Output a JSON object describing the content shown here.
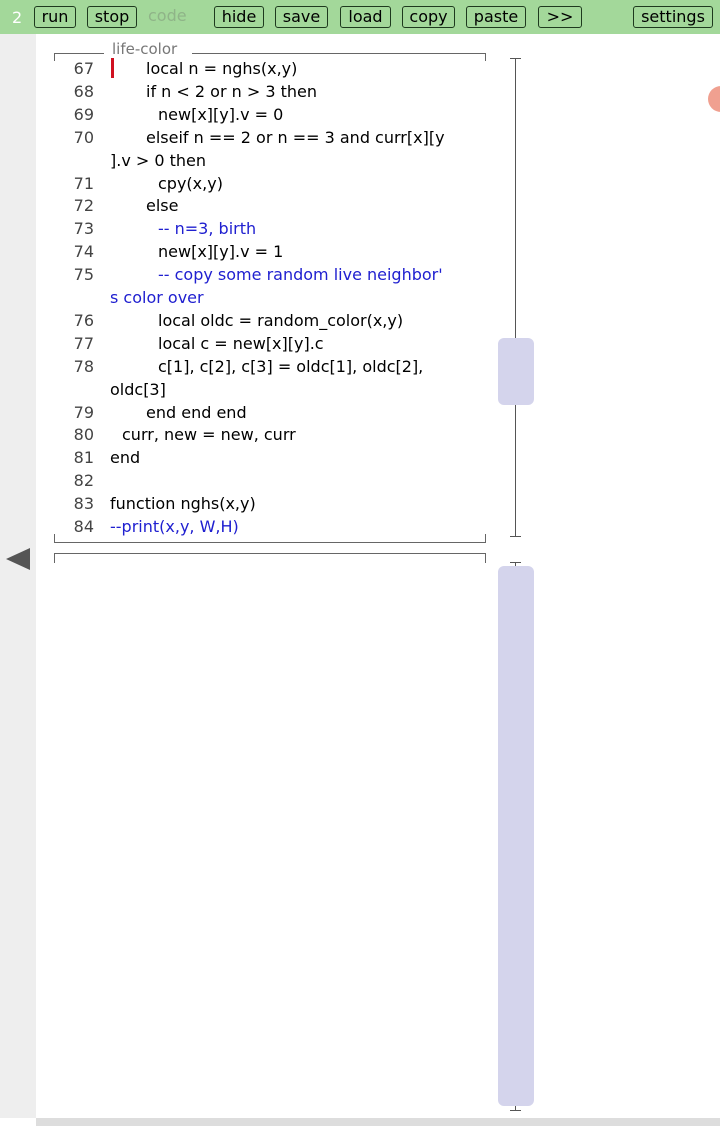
{
  "toolbar": {
    "tab_number": "2",
    "run_label": "run",
    "stop_label": "stop",
    "code_label": "code",
    "hide_label": "hide",
    "save_label": "save",
    "load_label": "load",
    "copy_label": "copy",
    "paste_label": "paste",
    "more_label": ">>",
    "settings_label": "settings"
  },
  "editor": {
    "title": "life-color",
    "lines": [
      {
        "num": "67",
        "text": "local n = nghs(x,y)",
        "indent": 3,
        "kind": "code"
      },
      {
        "num": "68",
        "text": "if n < 2 or n > 3 then",
        "indent": 3,
        "kind": "code"
      },
      {
        "num": "69",
        "text": "new[x][y].v = 0",
        "indent": 4,
        "kind": "code"
      },
      {
        "num": "70",
        "text": "elseif n == 2 or n == 3 and curr[x][y",
        "indent": 3,
        "kind": "code"
      },
      {
        "num": "",
        "text": "].v > 0 then",
        "indent": 0,
        "kind": "code"
      },
      {
        "num": "71",
        "text": "cpy(x,y)",
        "indent": 4,
        "kind": "code"
      },
      {
        "num": "72",
        "text": "else",
        "indent": 3,
        "kind": "code"
      },
      {
        "num": "73",
        "text": "-- n=3, birth",
        "indent": 4,
        "kind": "comment"
      },
      {
        "num": "74",
        "text": "new[x][y].v = 1",
        "indent": 4,
        "kind": "code"
      },
      {
        "num": "75",
        "text": "-- copy some random live neighbor'",
        "indent": 4,
        "kind": "comment"
      },
      {
        "num": "",
        "text": "s color over",
        "indent": 0,
        "kind": "comment"
      },
      {
        "num": "76",
        "text": "local oldc = random_color(x,y)",
        "indent": 4,
        "kind": "code"
      },
      {
        "num": "77",
        "text": "local c = new[x][y].c",
        "indent": 4,
        "kind": "code"
      },
      {
        "num": "78",
        "text": "c[1], c[2], c[3] = oldc[1], oldc[2],",
        "indent": 4,
        "kind": "code"
      },
      {
        "num": "",
        "text": "oldc[3]",
        "indent": 0,
        "kind": "code"
      },
      {
        "num": "79",
        "text": "end end end",
        "indent": 3,
        "kind": "code"
      },
      {
        "num": "80",
        "text": "curr, new = new, curr",
        "indent": 1,
        "kind": "code"
      },
      {
        "num": "81",
        "text": "end",
        "indent": 0,
        "kind": "code"
      },
      {
        "num": "82",
        "text": "",
        "indent": 0,
        "kind": "code"
      },
      {
        "num": "83",
        "text": "function nghs(x,y)",
        "indent": 0,
        "kind": "code"
      },
      {
        "num": "84",
        "text": "--print(x,y, W,H)",
        "indent": 0,
        "kind": "comment"
      }
    ]
  },
  "colors": {
    "toolbar_bg": "#a3d89a",
    "comment": "#2020d0",
    "cursor": "#d01020",
    "scroll_thumb": "#d4d4ec"
  },
  "icons": {
    "back": "left-triangle-icon"
  }
}
